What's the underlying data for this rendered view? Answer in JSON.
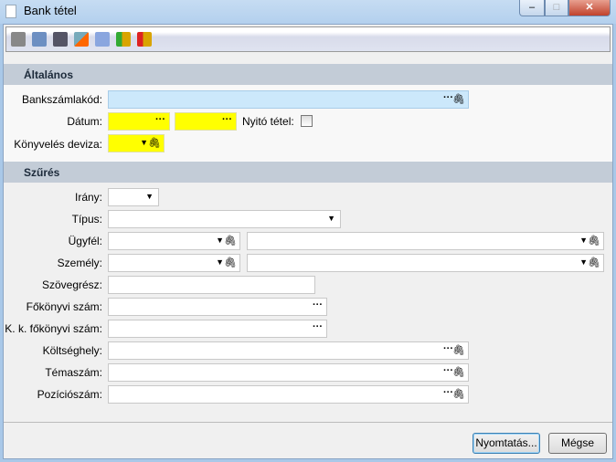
{
  "window": {
    "title": "Bank tétel",
    "minimize": "‒",
    "maximize": "□",
    "close": "✕"
  },
  "toolbar": [
    "print-icon",
    "settings-doc-icon",
    "attachment-doc-icon",
    "edit-doc-icon",
    "calculator-icon",
    "coins-green-icon",
    "coins-red-icon"
  ],
  "sections": {
    "general": "Általános",
    "filter": "Szűrés"
  },
  "labels": {
    "bank_account": "Bankszámlakód:",
    "date": "Dátum:",
    "opening": "Nyitó tétel:",
    "currency": "Könyvelés deviza:",
    "direction": "Irány:",
    "type": "Típus:",
    "client": "Ügyfél:",
    "person": "Személy:",
    "text": "Szövegrész:",
    "ledger": "Főkönyvi szám:",
    "kk_ledger": "K. k. főkönyvi szám:",
    "cost_center": "Költséghely:",
    "topic": "Témaszám:",
    "position": "Pozíciószám:"
  },
  "glyphs": {
    "dots": "···",
    "arrow": "▼",
    "clip": "🖇"
  },
  "buttons": {
    "print": "Nyomtatás...",
    "cancel": "Mégse"
  },
  "colors": {
    "required": "#ffff00",
    "focused": "#cce8fb"
  }
}
